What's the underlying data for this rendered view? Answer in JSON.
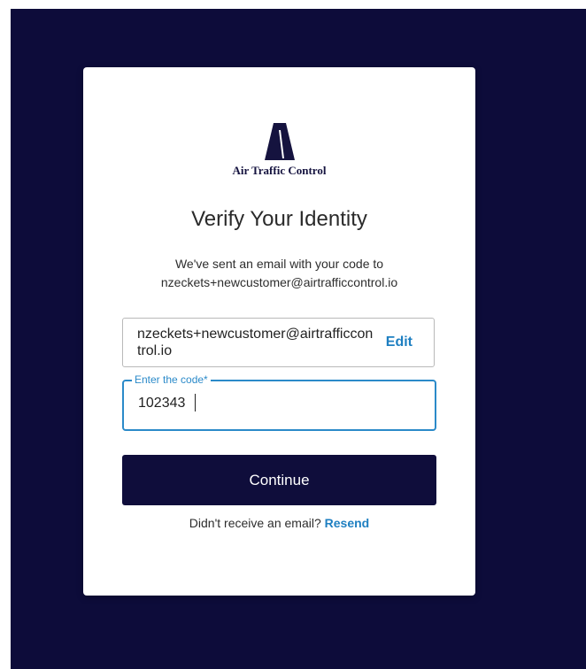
{
  "brand": {
    "name": "Air Traffic Control",
    "logo_color": "#15133f"
  },
  "page": {
    "title": "Verify Your Identity",
    "subtitle_line1": "We've sent an email with your code to",
    "subtitle_line2": "nzeckets+newcustomer@airtrafficcontrol.io"
  },
  "email_box": {
    "value": "nzeckets+newcustomer@airtrafficcontrol.io",
    "edit_label": "Edit"
  },
  "code_field": {
    "label": "Enter the code*",
    "value": "102343"
  },
  "continue_button": {
    "label": "Continue"
  },
  "resend": {
    "prompt": "Didn't receive an email?",
    "link_label": "Resend"
  },
  "colors": {
    "backdrop": "#0d0c3a",
    "accent": "#2b8ac9",
    "link": "#1e7fc1",
    "button": "#0f0d3b"
  }
}
